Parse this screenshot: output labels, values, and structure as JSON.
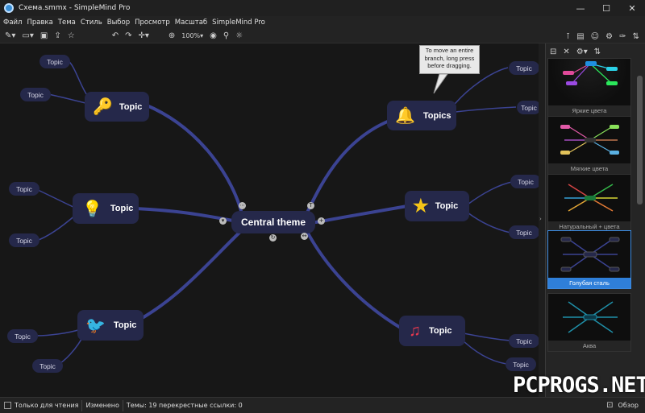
{
  "window": {
    "title": "Схема.smmx - SimpleMind Pro",
    "minimize": "—",
    "maximize": "☐",
    "close": "✕"
  },
  "menu": [
    "Файл",
    "Правка",
    "Тема",
    "Стиль",
    "Выбор",
    "Просмотр",
    "Масштаб",
    "SimpleMind Pro"
  ],
  "toolbar": {
    "zoom": "100%",
    "zoom_arrow": "▾"
  },
  "mindmap": {
    "central": "Central theme",
    "tooltip": [
      "To move an entire",
      "branch, long press",
      "before dragging."
    ],
    "main_topics": [
      {
        "label": "Topic",
        "icon": "key-icon"
      },
      {
        "label": "Topic",
        "icon": "lightbulb-icon"
      },
      {
        "label": "Topic",
        "icon": "bird-icon"
      },
      {
        "label": "Topics",
        "icon": "bell-icon"
      },
      {
        "label": "Topic",
        "icon": "star-icon"
      },
      {
        "label": "Topic",
        "icon": "music-note-icon"
      }
    ],
    "subtopics": [
      "Topic",
      "Topic",
      "Topic",
      "Topic",
      "Topic",
      "Topic",
      "Topic",
      "Topic",
      "Topic",
      "Topic",
      "Topic",
      "Topic"
    ]
  },
  "themes_panel": {
    "themes": [
      {
        "label": "Яркие цвета",
        "selected": false
      },
      {
        "label": "Мягкие цвета",
        "selected": false
      },
      {
        "label": "Натуральный + цвета",
        "selected": false
      },
      {
        "label": "Голубая сталь",
        "selected": true
      },
      {
        "label": "Аква",
        "selected": false
      }
    ]
  },
  "status": {
    "readonly_label": "Только для чтения",
    "modified": "Изменено",
    "stats": "Темы: 19 перекрестные ссылки: 0",
    "overview": "Обзор"
  },
  "watermark": "PCPROGS.NET",
  "colors": {
    "node_fill": "#25284a",
    "branch": "#3b4392",
    "accent": "#2f7fd9"
  }
}
